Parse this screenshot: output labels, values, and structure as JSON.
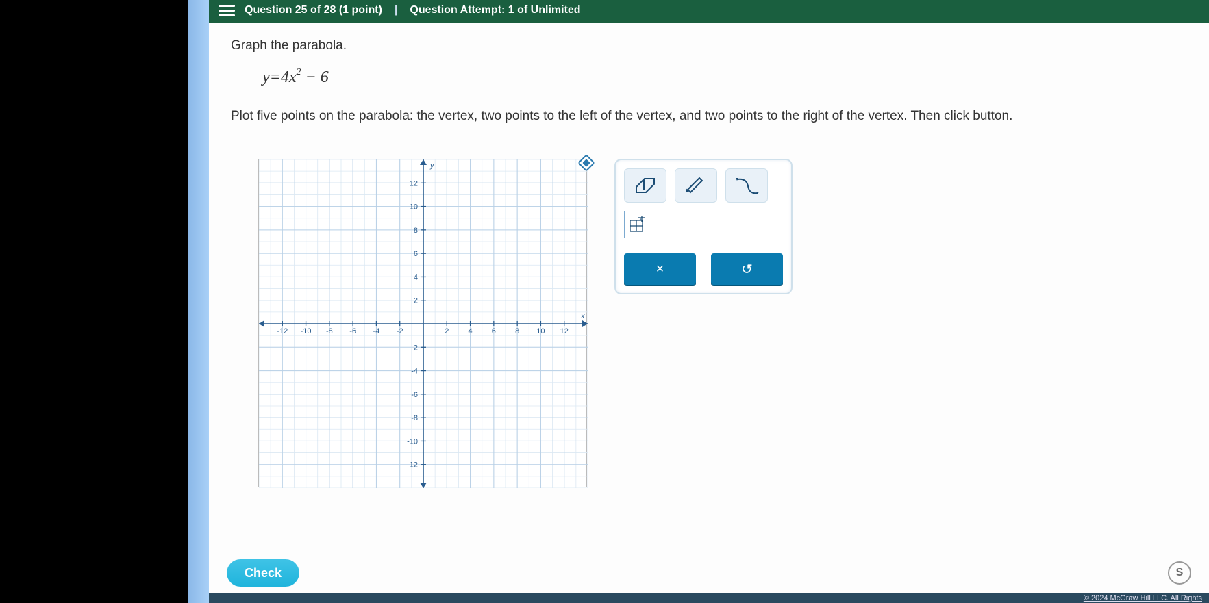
{
  "header": {
    "question_progress": "Question 25 of 28 (1 point)",
    "attempt": "Question Attempt: 1 of Unlimited"
  },
  "prompt_title": "Graph the parabola.",
  "equation": {
    "lhs": "y",
    "eq": "=",
    "coef": "4",
    "var": "x",
    "exp": "2",
    "tail": " − 6"
  },
  "instructions": "Plot five points on the parabola: the vertex, two points to the left of the vertex, and two points to the right of the vertex. Then click button.",
  "tools": {
    "eraser": "eraser-icon",
    "pencil": "pencil-icon",
    "curve": "curve-icon",
    "zoom_grid": "zoom-grid-icon",
    "clear": "×",
    "reset": "↺"
  },
  "footer": {
    "check_label": "Check",
    "side_label": "S"
  },
  "bottom_bar": "© 2024 McGraw Hill LLC. All Rights",
  "chart_data": {
    "type": "scatter",
    "title": "",
    "xlabel": "x",
    "ylabel": "y",
    "xlim": [
      -14,
      14
    ],
    "ylim": [
      -14,
      14
    ],
    "x_ticks": [
      -12,
      -10,
      -8,
      -6,
      -4,
      -2,
      2,
      4,
      6,
      8,
      10,
      12
    ],
    "y_ticks": [
      -12,
      -10,
      -8,
      -6,
      -4,
      -2,
      2,
      4,
      6,
      8,
      10,
      12
    ],
    "series": []
  }
}
